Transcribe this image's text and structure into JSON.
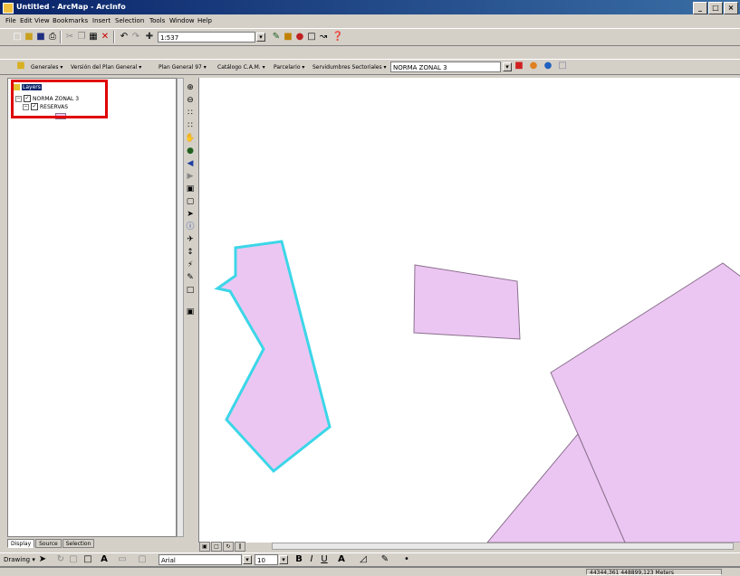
{
  "window": {
    "title": "Untitled - ArcMap - ArcInfo",
    "min_label": "_",
    "max_label": "□",
    "close_label": "×"
  },
  "menubar": {
    "items": [
      "File",
      "Edit",
      "View",
      "Bookmarks",
      "Insert",
      "Selection",
      "Tools",
      "Window",
      "Help"
    ]
  },
  "standard_toolbar": {
    "scale_value": "1:537"
  },
  "custom_toolbar": {
    "items": [
      "Generales ▾",
      "Versión del Plan General ▾",
      "Plan General 97 ▾",
      "Catálogo C.A.M. ▾",
      "Parcelario ▾",
      "Servidumbres Sectoriales ▾"
    ],
    "layer_value": "NORMA ZONAL 3"
  },
  "toc": {
    "layers_label": "Layers",
    "layer_name": "NORMA ZONAL 3",
    "sublayer_name": "RESERVAS"
  },
  "toc_tabs": [
    "Display",
    "Source",
    "Selection"
  ],
  "drawing_toolbar": {
    "drawing_label": "Drawing ▾",
    "font_value": "Arial",
    "size_value": "10",
    "bold": "B",
    "italic": "I",
    "underline": "U"
  },
  "status": {
    "coordinates": "44344,361  448899,123 Meters"
  },
  "colors": {
    "polygon_fill": "#ecc6f2",
    "polygon_stroke": "#8a708e",
    "selection": "#3cd6e8",
    "highlight_box": "#e00000"
  }
}
